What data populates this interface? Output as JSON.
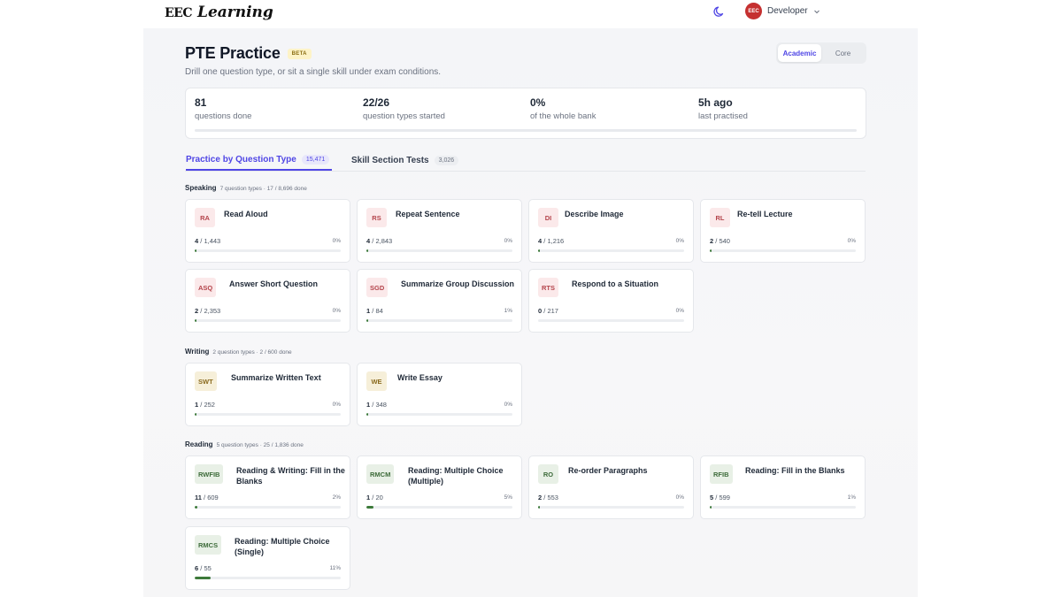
{
  "header": {
    "logo_mark": "EEC",
    "logo_text": "Learning",
    "user_name": "Developer",
    "avatar_text": "EEC"
  },
  "page": {
    "title": "PTE Practice",
    "badge": "BETA",
    "subtitle": "Drill one question type, or sit a single skill under exam conditions.",
    "toggle": [
      "Academic",
      "Core"
    ],
    "toggle_active": "Academic"
  },
  "stats": [
    {
      "value": "81",
      "label": "questions done"
    },
    {
      "value": "22/26",
      "label": "question types started"
    },
    {
      "value": "0%",
      "label": "of the whole bank"
    },
    {
      "value": "5h ago",
      "label": "last practised"
    }
  ],
  "tabs": [
    {
      "label": "Practice by Question Type",
      "count": "15,471"
    },
    {
      "label": "Skill Section Tests",
      "count": "3,026"
    }
  ],
  "sections": [
    {
      "name": "Speaking",
      "meta": "7 question types · 17 / 8,696 done",
      "kind": "speak",
      "cards": [
        {
          "code": "RA",
          "name": "Read Aloud",
          "done": "4",
          "total": "1,443",
          "pct": "0%",
          "progress": 0.003
        },
        {
          "code": "RS",
          "name": "Repeat Sentence",
          "done": "4",
          "total": "2,843",
          "pct": "0%",
          "progress": 0.0014
        },
        {
          "code": "DI",
          "name": "Describe Image",
          "done": "4",
          "total": "1,216",
          "pct": "0%",
          "progress": 0.003
        },
        {
          "code": "RL",
          "name": "Re-tell Lecture",
          "done": "2",
          "total": "540",
          "pct": "0%",
          "progress": 0.004
        },
        {
          "code": "ASQ",
          "name": "Answer Short Question",
          "done": "2",
          "total": "2,353",
          "pct": "0%",
          "progress": 0.001
        },
        {
          "code": "SGD",
          "name": "Summarize Group Discussion",
          "done": "1",
          "total": "84",
          "pct": "1%",
          "progress": 0.012
        },
        {
          "code": "RTS",
          "name": "Respond to a Situation",
          "done": "0",
          "total": "217",
          "pct": "0%",
          "progress": 0
        }
      ]
    },
    {
      "name": "Writing",
      "meta": "2 question types · 2 / 600 done",
      "kind": "write",
      "cards": [
        {
          "code": "SWT",
          "name": "Summarize Written Text",
          "done": "1",
          "total": "252",
          "pct": "0%",
          "progress": 0.004
        },
        {
          "code": "WE",
          "name": "Write Essay",
          "done": "1",
          "total": "348",
          "pct": "0%",
          "progress": 0.003
        }
      ]
    },
    {
      "name": "Reading",
      "meta": "5 question types · 25 / 1,836 done",
      "kind": "read",
      "cards": [
        {
          "code": "RWFIB",
          "name": "Reading & Writing: Fill in the Blanks",
          "done": "11",
          "total": "609",
          "pct": "2%",
          "progress": 0.018
        },
        {
          "code": "RMCM",
          "name": "Reading: Multiple Choice (Multiple)",
          "done": "1",
          "total": "20",
          "pct": "5%",
          "progress": 0.05
        },
        {
          "code": "RO",
          "name": "Re-order Paragraphs",
          "done": "2",
          "total": "553",
          "pct": "0%",
          "progress": 0.004
        },
        {
          "code": "RFIB",
          "name": "Reading: Fill in the Blanks",
          "done": "5",
          "total": "599",
          "pct": "1%",
          "progress": 0.008
        },
        {
          "code": "RMCS",
          "name": "Reading: Multiple Choice (Single)",
          "done": "6",
          "total": "55",
          "pct": "11%",
          "progress": 0.11
        }
      ]
    }
  ],
  "colors": {
    "accent": "#4f46e5",
    "progress_fill": "#3d7a3a"
  }
}
